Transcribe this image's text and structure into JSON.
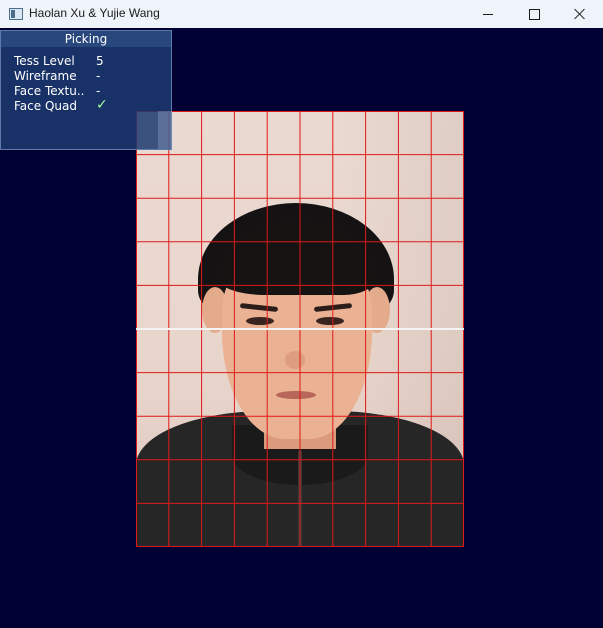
{
  "window": {
    "title": "Haolan Xu & Yujie Wang",
    "icon": "app-window-icon",
    "controls": [
      "minimize-icon",
      "maximize-icon",
      "close-icon"
    ]
  },
  "viewport": {
    "background_color": "#000032",
    "grid_color": "#e01818",
    "grid_columns": 10,
    "grid_rows": 10
  },
  "panel": {
    "title": "Picking",
    "rows": [
      {
        "label": "Tess Level",
        "value": "5"
      },
      {
        "label": "Wireframe",
        "value": "-"
      },
      {
        "label": "Face Textu..",
        "value": "-"
      },
      {
        "label": "Face Quad",
        "value": "✓"
      }
    ]
  },
  "footer": {
    "help_icon": "?"
  }
}
